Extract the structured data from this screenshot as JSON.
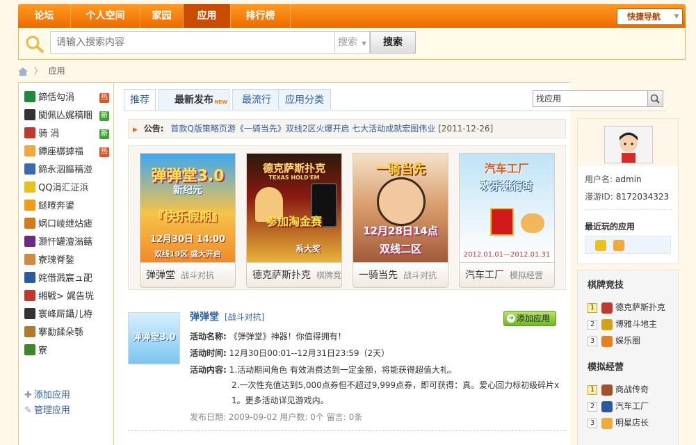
{
  "topnav": {
    "items": [
      "论坛",
      "个人空间",
      "家园",
      "应用",
      "排行榜"
    ],
    "quick_nav": "快捷导航"
  },
  "search": {
    "placeholder": "请输入搜索内容",
    "scope": "搜索",
    "button": "搜索"
  },
  "breadcrumb": {
    "current": "应用"
  },
  "sidebar": {
    "items": [
      {
        "label": "鍗佸勾涓",
        "badge": "热",
        "color": "#1e8a3a"
      },
      {
        "label": "闃佩亾娓稿睏",
        "badge": "新",
        "color": "#333333"
      },
      {
        "label": "骑 涓",
        "badge": "新",
        "color": "#c0392b"
      },
      {
        "label": "鐔座樼摢福",
        "badge": "热",
        "color": "#f0a93a"
      },
      {
        "label": "鍗永泅鏂稿湴",
        "badge": "",
        "color": "#3b6ab5"
      },
      {
        "label": "QQ涓汇泟浜",
        "badge": "",
        "color": "#e8c11d"
      },
      {
        "label": "鎹曢奔鍙",
        "badge": "",
        "color": "#f39c12"
      },
      {
        "label": "娲口崚绁炶瘧",
        "badge": "",
        "color": "#d47a1a"
      },
      {
        "label": "灏忓罐澶滃簵",
        "badge": "",
        "color": "#6b2a8a"
      },
      {
        "label": "寮瑰脊鍫",
        "badge": "",
        "color": "#d18b3c"
      },
      {
        "label": "姹借溅宸ュ巶",
        "badge": "",
        "color": "#2a5aa0"
      },
      {
        "label": "缃戦> 娓告垙",
        "badge": "",
        "color": "#c0392b"
      },
      {
        "label": "寰峰厛鑷儿栫",
        "badge": "",
        "color": "#333333"
      },
      {
        "label": "搴勫鍒朵綔",
        "badge": "",
        "color": "#b07a2a"
      },
      {
        "label": "寮",
        "badge": "",
        "color": "#3a8a2a"
      }
    ],
    "add_app": "添加应用",
    "manage_app": "管理应用"
  },
  "tabs": [
    "推荐",
    "最新发布",
    "最流行",
    "应用分类"
  ],
  "tab_new_tag": "NEW",
  "find_app": "找应用",
  "notice": {
    "label": "公告:",
    "text": "首款Q版策略页游《一骑当先》双线2区火爆开启 七大活动成就宏图伟业",
    "date": "[2011-12-26]"
  },
  "games": [
    {
      "name": "弹弹堂",
      "category": "战斗对抗",
      "img_title": "弹弹堂3.0",
      "img_sub": "新纪元",
      "img_line1": "『快乐假期』",
      "img_line2": "12月30日 14:00",
      "img_line3": "双线19区 盛大开启"
    },
    {
      "name": "德克萨斯扑克",
      "category": "棋牌竞",
      "img_title": "德克萨斯扑克",
      "img_sub": "TEXAS HOLD'EM",
      "img_line1": "参加淘金赛",
      "img_line2": "系大奖"
    },
    {
      "name": "一骑当先",
      "category": "战斗对抗",
      "img_title": "一骑当先",
      "img_line1": "12月28日14点",
      "img_line2": "双线二区"
    },
    {
      "name": "汽车工厂",
      "category": "模拟经营",
      "img_title": "汽车工厂",
      "img_sub": "欢乐进行时",
      "img_line1": "2012.01.01—2012.01.31"
    }
  ],
  "detail": {
    "thumb_text": "弹弹堂3.0",
    "title": "弹弹堂",
    "category": "[战斗对抗]",
    "add_button": "添加应用",
    "rows": [
      {
        "key": "活动名称:",
        "value": "《弹弹堂》神器！你值得拥有！"
      },
      {
        "key": "活动时间:",
        "value": "12月30日00:01--12月31日23:59（2天）"
      },
      {
        "key": "活动内容:",
        "value": "1.活动期间角色 有效消费达到一定金额，将能获得超值大礼。"
      },
      {
        "key": "",
        "value": "2.一次性充值达到5,000点券但不超过9,999点券，即可获得：真。爱心回力标初级碎片x"
      },
      {
        "key": "",
        "value": "1。更多活动详见游戏内。"
      }
    ],
    "meta": "发布日期: 2009-09-02 用户数: 0个  留言: 0条"
  },
  "profile": {
    "username_label": "用户名:",
    "username": "admin",
    "id_label": "漫游ID:",
    "id": "8172034323",
    "recent_title": "最近玩的应用"
  },
  "rank": {
    "sections": [
      {
        "title": "棋牌竞技",
        "items": [
          {
            "num": "1",
            "label": "德克萨斯扑克",
            "color": "#c0392b"
          },
          {
            "num": "2",
            "label": "博雅斗地主",
            "color": "#d4a017"
          },
          {
            "num": "3",
            "label": "娱乐圈",
            "color": "#e67e22"
          }
        ]
      },
      {
        "title": "模拟经营",
        "items": [
          {
            "num": "1",
            "label": "商战传奇",
            "color": "#a0522d"
          },
          {
            "num": "2",
            "label": "汽车工厂",
            "color": "#2a5aa0"
          },
          {
            "num": "3",
            "label": "明星店长",
            "color": "#f0a93a"
          }
        ]
      }
    ]
  },
  "colors": {
    "nav_orange": "#ec6a00",
    "link_blue": "#2b5fa8",
    "hot_badge": "#e6501c",
    "new_badge": "#3aa52b"
  }
}
